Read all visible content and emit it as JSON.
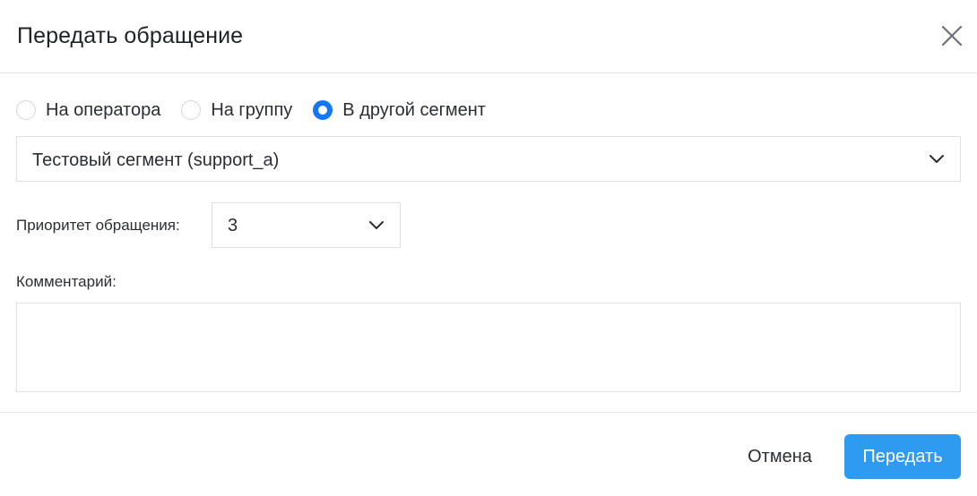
{
  "dialog": {
    "title": "Передать обращение"
  },
  "transfer_options": [
    {
      "label": "На оператора",
      "checked": false
    },
    {
      "label": "На группу",
      "checked": false
    },
    {
      "label": "В другой сегмент",
      "checked": true
    }
  ],
  "segment_select": {
    "value": "Тестовый сегмент (support_a)"
  },
  "priority": {
    "label": "Приоритет обращения:",
    "value": "3"
  },
  "comment": {
    "label": "Комментарий:",
    "value": ""
  },
  "footer": {
    "cancel_label": "Отмена",
    "submit_label": "Передать"
  },
  "colors": {
    "accent": "#1677f2",
    "submit_button": "#2f9bf0",
    "border": "#dcdfe3",
    "divider": "#e3e6ea"
  },
  "icons": {
    "close": "close-icon",
    "dropdown": "chevron-down-icon"
  }
}
